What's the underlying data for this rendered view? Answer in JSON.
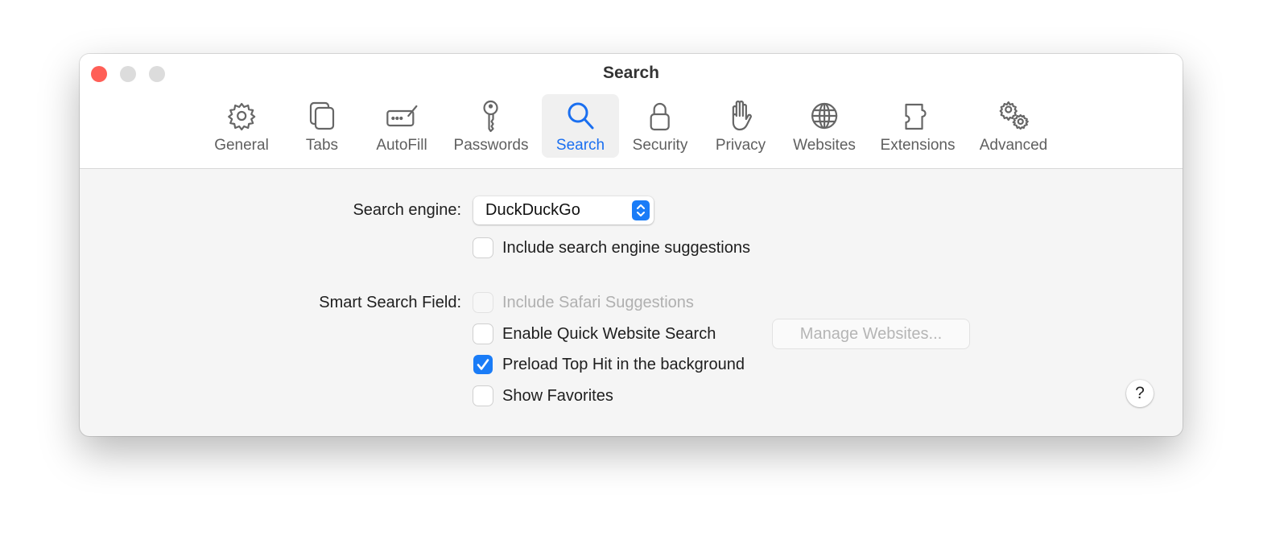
{
  "window": {
    "title": "Search"
  },
  "traffic_lights": {
    "close": "#ff5f57",
    "minimize": "#dcdcdc",
    "zoom": "#dcdcdc"
  },
  "accent_color": "#1a7cf7",
  "tabs": [
    {
      "label": "General",
      "icon": "gear-icon",
      "active": false
    },
    {
      "label": "Tabs",
      "icon": "tabs-icon",
      "active": false
    },
    {
      "label": "AutoFill",
      "icon": "autofill-icon",
      "active": false
    },
    {
      "label": "Passwords",
      "icon": "key-icon",
      "active": false
    },
    {
      "label": "Search",
      "icon": "magnifier-icon",
      "active": true
    },
    {
      "label": "Security",
      "icon": "lock-icon",
      "active": false
    },
    {
      "label": "Privacy",
      "icon": "hand-icon",
      "active": false
    },
    {
      "label": "Websites",
      "icon": "globe-icon",
      "active": false
    },
    {
      "label": "Extensions",
      "icon": "puzzle-icon",
      "active": false
    },
    {
      "label": "Advanced",
      "icon": "gears-icon",
      "active": false
    }
  ],
  "search_engine": {
    "label": "Search engine:",
    "value": "DuckDuckGo"
  },
  "include_suggestions": {
    "label": "Include search engine suggestions",
    "checked": false
  },
  "smart_search": {
    "label": "Smart Search Field:",
    "options": [
      {
        "label": "Include Safari Suggestions",
        "checked": false,
        "disabled": true
      },
      {
        "label": "Enable Quick Website Search",
        "checked": false,
        "disabled": false
      },
      {
        "label": "Preload Top Hit in the background",
        "checked": true,
        "disabled": false
      },
      {
        "label": "Show Favorites",
        "checked": false,
        "disabled": false
      }
    ],
    "manage_button": "Manage Websites..."
  },
  "help_button": "?"
}
